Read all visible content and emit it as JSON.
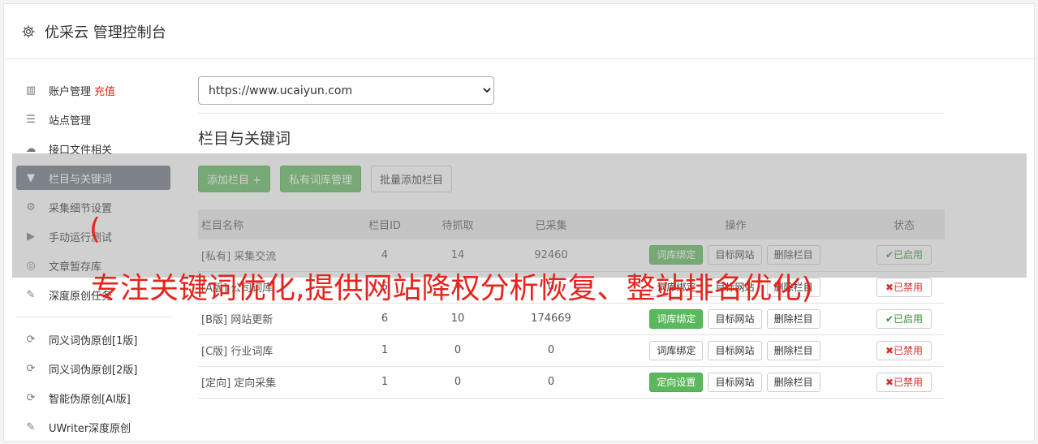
{
  "header": {
    "title": "优采云 管理控制台"
  },
  "sidebar": {
    "group1": [
      {
        "label": "账户管理",
        "extra": "充值",
        "icon": "bar-chart-icon"
      },
      {
        "label": "站点管理",
        "icon": "server-icon"
      },
      {
        "label": "接口文件相关",
        "icon": "cloud-upload-icon"
      },
      {
        "label": "栏目与关键词",
        "icon": "filter-icon",
        "active": true
      },
      {
        "label": "采集细节设置",
        "icon": "cogs-icon"
      },
      {
        "label": "手动运行测试",
        "icon": "play-circle-icon"
      },
      {
        "label": "文章暂存库",
        "icon": "database-icon"
      },
      {
        "label": "深度原创任务",
        "icon": "edit-icon"
      }
    ],
    "group2": [
      {
        "label": "同义词伪原创[1版]",
        "icon": "refresh-icon"
      },
      {
        "label": "同义词伪原创[2版]",
        "icon": "refresh-icon"
      },
      {
        "label": "智能伪原创[AI版]",
        "icon": "refresh-icon"
      },
      {
        "label": "UWriter深度原创",
        "icon": "edit-icon"
      }
    ]
  },
  "main": {
    "site_select": "https://www.ucaiyun.com",
    "section_title": "栏目与关键词",
    "buttons": {
      "add": "添加栏目 +",
      "private": "私有词库管理",
      "batch": "批量添加栏目"
    },
    "table": {
      "headers": [
        "栏目名称",
        "栏目ID",
        "待抓取",
        "已采集",
        "操作",
        "状态"
      ],
      "rows": [
        {
          "tag": "[私有]",
          "name": "采集交流",
          "id": "4",
          "pending": "14",
          "collected": "92460",
          "op1": "词库绑定",
          "op2": "目标网站",
          "op3": "删除栏目",
          "status": "已启用"
        },
        {
          "tag": "[A版]",
          "name": "公司词库",
          "id": "5",
          "pending": "4",
          "collected": "0",
          "op1": "词库绑定",
          "op2": "目标网站",
          "op3": "删除栏目",
          "status": "已禁用"
        },
        {
          "tag": "[B版]",
          "name": "网站更新",
          "id": "6",
          "pending": "10",
          "collected": "174669",
          "op1": "词库绑定",
          "op2": "目标网站",
          "op3": "删除栏目",
          "status": "已启用"
        },
        {
          "tag": "[C版]",
          "name": "行业词库",
          "id": "1",
          "pending": "0",
          "collected": "0",
          "op1": "词库绑定",
          "op2": "目标网站",
          "op3": "删除栏目",
          "status": "已禁用"
        },
        {
          "tag": "[定向]",
          "name": "定向采集",
          "id": "1",
          "pending": "0",
          "collected": "0",
          "op1": "定向设置",
          "op2": "目标网站",
          "op3": "删除栏目",
          "status": "已禁用"
        }
      ]
    }
  },
  "overlay": {
    "paren": "(",
    "text": "专注关键词优化,提供网站降权分析恢复、整站排名优化)"
  }
}
